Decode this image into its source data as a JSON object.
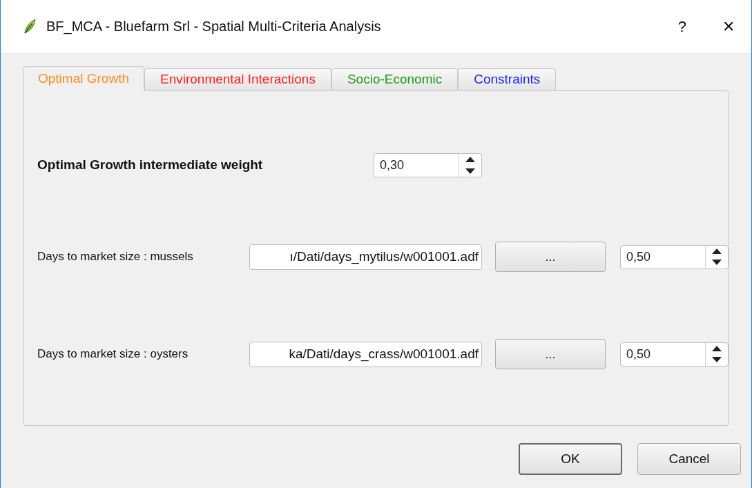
{
  "window": {
    "title": "BF_MCA - Bluefarm Srl - Spatial Multi-Criteria Analysis",
    "help": "?",
    "close": "✕"
  },
  "tabs": [
    {
      "label": "Optimal Growth",
      "selected": true,
      "color": "#ff8c1f"
    },
    {
      "label": "Environmental Interactions",
      "selected": false,
      "color": "#ff1f1f"
    },
    {
      "label": "Socio-Economic",
      "selected": false,
      "color": "#1f9a1f"
    },
    {
      "label": "Constraints",
      "selected": false,
      "color": "#1f1fff"
    }
  ],
  "weight": {
    "label": "Optimal Growth intermediate weight",
    "value": "0,30"
  },
  "rows": [
    {
      "label": "Days to market size : mussels",
      "path": "ı/Dati/days_mytilus/w001001.adf",
      "browse": "...",
      "value": "0,50"
    },
    {
      "label": "Days to market size : oysters",
      "path": "ka/Dati/days_crass/w001001.adf",
      "browse": "...",
      "value": "0,50"
    }
  ],
  "buttons": [
    {
      "label": "OK",
      "kind": "default"
    },
    {
      "label": "Cancel",
      "kind": "normal"
    }
  ]
}
